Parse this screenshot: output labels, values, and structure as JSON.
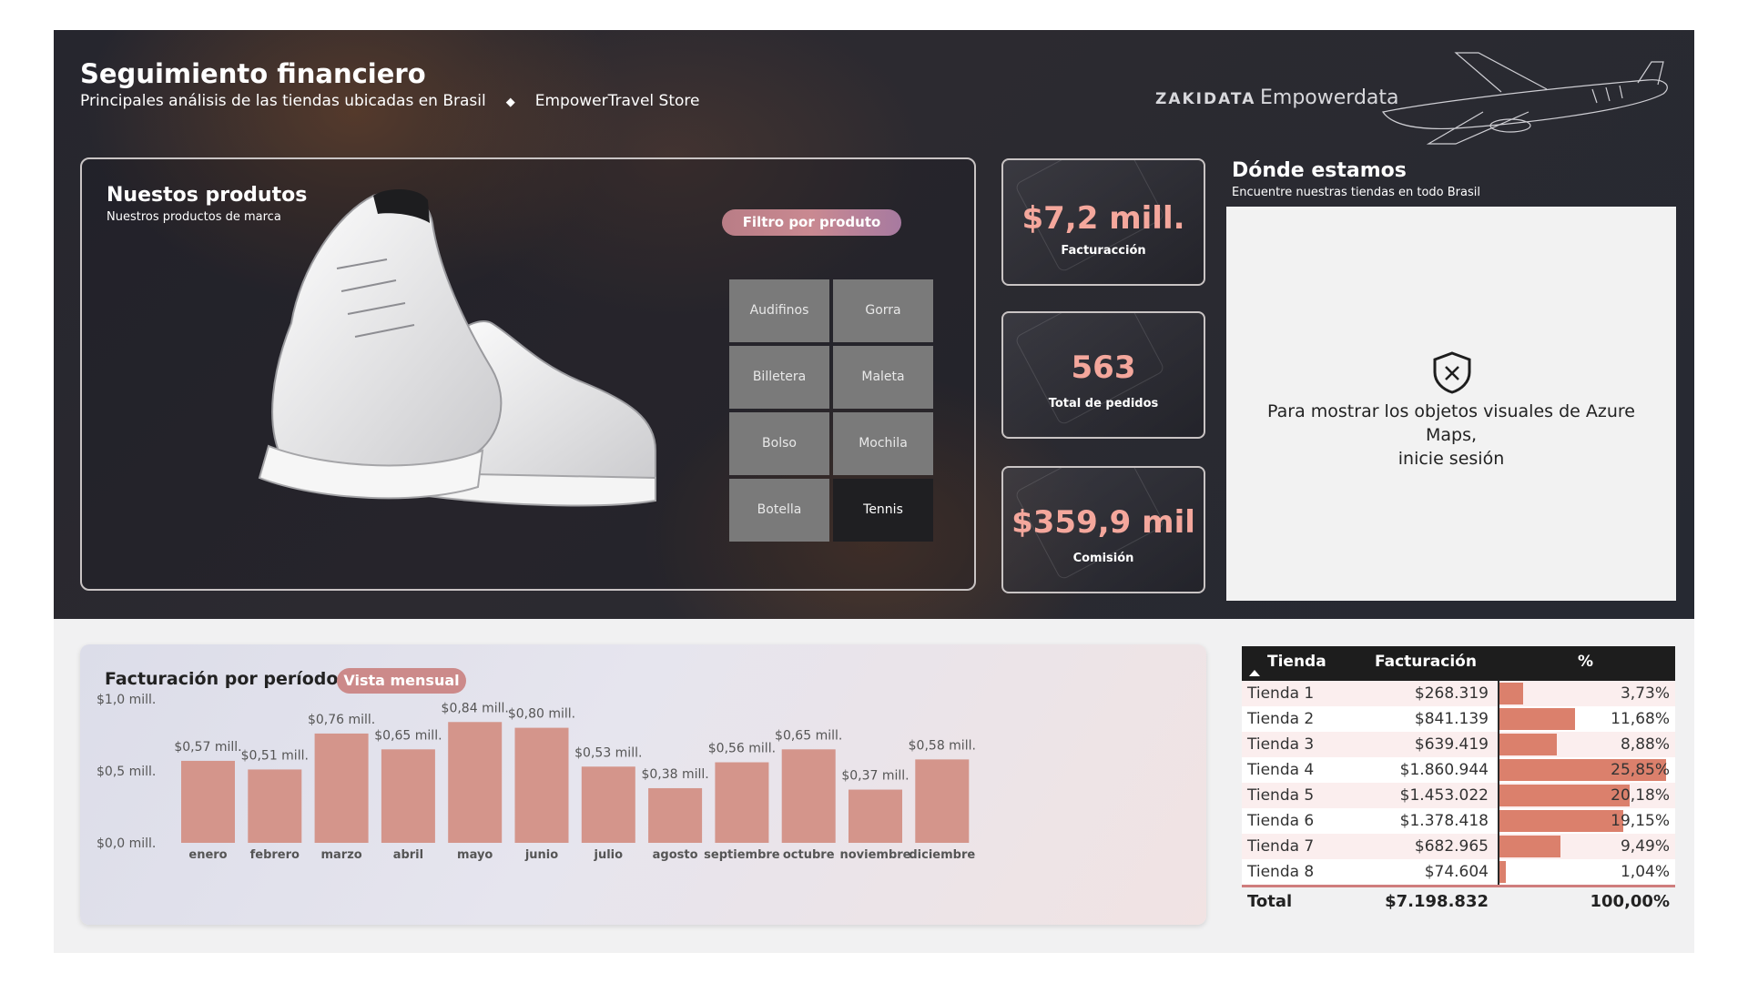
{
  "header": {
    "title": "Seguimiento financiero",
    "subtitle": "Principales análisis de las tiendas ubicadas en Brasil",
    "separator": "◆",
    "store": "EmpowerTravel Store",
    "brand_zakidata": "ZAKIDATA",
    "brand_empowerdata": "Empowerdata"
  },
  "products": {
    "title": "Nuestos produtos",
    "subtitle": "Nuestros productos de marca",
    "filter_label": "Filtro por produto",
    "items": [
      "Audifinos",
      "Gorra",
      "Billetera",
      "Maleta",
      "Bolso",
      "Mochila",
      "Botella",
      "Tennis"
    ],
    "selected": "Tennis"
  },
  "kpis": [
    {
      "value": "$7,2 mill.",
      "label": "Facturacción"
    },
    {
      "value": "563",
      "label": "Total de pedidos"
    },
    {
      "value": "$359,9 mil",
      "label": "Comisión"
    }
  ],
  "map": {
    "title": "Dónde estamos",
    "subtitle": "Encuentre nuestras tiendas en todo Brasil",
    "message_line1": "Para mostrar los objetos visuales de Azure Maps,",
    "message_line2": "inicie sesión",
    "icon": "shield-x-icon"
  },
  "chart": {
    "title": "Facturación por período",
    "view_pill": "Vista mensual"
  },
  "chart_data": {
    "type": "bar",
    "categories": [
      "enero",
      "febrero",
      "marzo",
      "abril",
      "mayo",
      "junio",
      "julio",
      "agosto",
      "septiembre",
      "octubre",
      "noviembre",
      "diciembre"
    ],
    "values": [
      0.57,
      0.51,
      0.76,
      0.65,
      0.84,
      0.8,
      0.53,
      0.38,
      0.56,
      0.65,
      0.37,
      0.58
    ],
    "value_labels": [
      "$0,57 mill.",
      "$0,51 mill.",
      "$0,76 mill.",
      "$0,65 mill.",
      "$0,84 mill.",
      "$0,80 mill.",
      "$0,53 mill.",
      "$0,38 mill.",
      "$0,56 mill.",
      "$0,65 mill.",
      "$0,37 mill.",
      "$0,58 mill."
    ],
    "yticks": [
      0.0,
      0.5,
      1.0
    ],
    "ytick_labels": [
      "$0,0 mill.",
      "$0,5 mill.",
      "$1,0 mill."
    ],
    "ylim": [
      0,
      1.0
    ],
    "color": "#d4958b",
    "grid": false
  },
  "table": {
    "headers": [
      "Tienda",
      "Facturación",
      "%"
    ],
    "rows": [
      {
        "name": "Tienda 1",
        "value": "$268.319",
        "pct": "3,73%",
        "share": 3.73
      },
      {
        "name": "Tienda 2",
        "value": "$841.139",
        "pct": "11,68%",
        "share": 11.68
      },
      {
        "name": "Tienda 3",
        "value": "$639.419",
        "pct": "8,88%",
        "share": 8.88
      },
      {
        "name": "Tienda 4",
        "value": "$1.860.944",
        "pct": "25,85%",
        "share": 25.85
      },
      {
        "name": "Tienda 5",
        "value": "$1.453.022",
        "pct": "20,18%",
        "share": 20.18
      },
      {
        "name": "Tienda 6",
        "value": "$1.378.418",
        "pct": "19,15%",
        "share": 19.15
      },
      {
        "name": "Tienda 7",
        "value": "$682.965",
        "pct": "9,49%",
        "share": 9.49
      },
      {
        "name": "Tienda 8",
        "value": "$74.604",
        "pct": "1,04%",
        "share": 1.04
      }
    ],
    "total": {
      "name": "Total",
      "value": "$7.198.832",
      "pct": "100,00%"
    }
  }
}
